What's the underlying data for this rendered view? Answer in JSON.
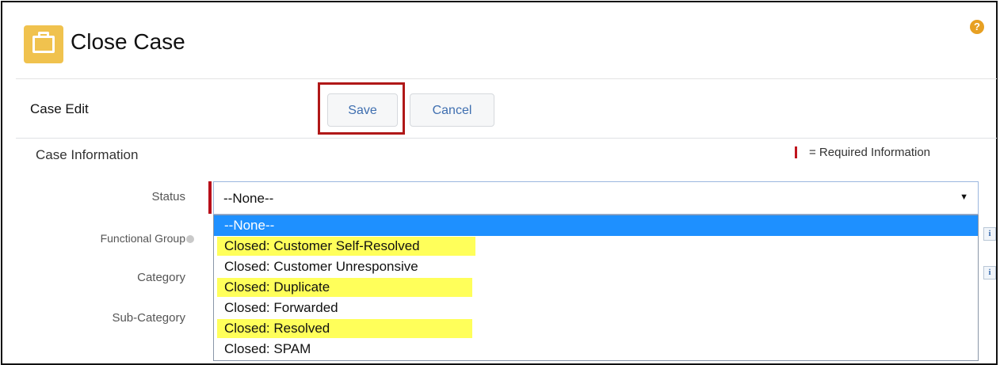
{
  "page": {
    "title": "Close Case",
    "icon": "briefcase-icon",
    "help_icon": "help-icon"
  },
  "edit": {
    "title": "Case Edit",
    "save_label": "Save",
    "cancel_label": "Cancel"
  },
  "section": {
    "title": "Case Information",
    "required_legend": "= Required Information"
  },
  "fields": {
    "status": {
      "label": "Status",
      "value": "--None--"
    },
    "functional_group": {
      "label": "Functional Group"
    },
    "category": {
      "label": "Category"
    },
    "sub_category": {
      "label": "Sub-Category"
    }
  },
  "dropdown": {
    "options": [
      {
        "label": "--None--",
        "selected": true,
        "highlighted": false
      },
      {
        "label": "Closed: Customer Self-Resolved",
        "selected": false,
        "highlighted": true
      },
      {
        "label": "Closed: Customer Unresponsive",
        "selected": false,
        "highlighted": false
      },
      {
        "label": "Closed: Duplicate",
        "selected": false,
        "highlighted": true
      },
      {
        "label": "Closed: Forwarded",
        "selected": false,
        "highlighted": false
      },
      {
        "label": "Closed: Resolved",
        "selected": false,
        "highlighted": true
      },
      {
        "label": "Closed: SPAM",
        "selected": false,
        "highlighted": false
      }
    ]
  },
  "side_info_label": "i",
  "colors": {
    "accent": "#3f6fb0",
    "required": "#c0141e",
    "selected_option": "#1e90ff",
    "highlight": "#ffff5a",
    "annotation_box": "#b01818",
    "briefcase": "#f0c24e"
  }
}
